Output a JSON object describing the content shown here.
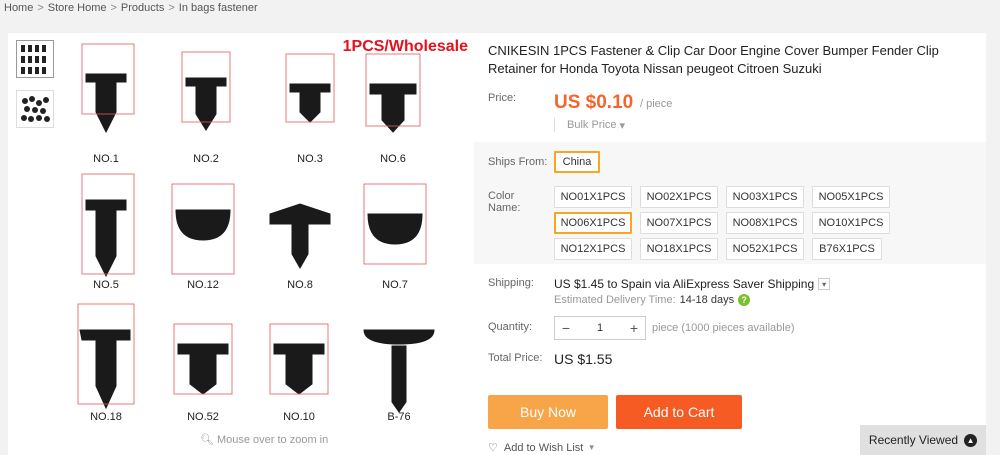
{
  "breadcrumb": [
    "Home",
    "Store Home",
    "Products",
    "In bags fastener"
  ],
  "image": {
    "overlay_title": "1PCS/Wholesale",
    "zoom_hint": "Mouse over to zoom in",
    "labels": [
      "NO.1",
      "NO.2",
      "NO.3",
      "NO.6",
      "NO.5",
      "NO.12",
      "NO.8",
      "NO.7",
      "NO.18",
      "NO.52",
      "NO.10",
      "B-76"
    ]
  },
  "product": {
    "title": "CNIKESIN 1PCS Fastener & Clip Car Door Engine Cover Bumper Fender Clip Retainer for Honda Toyota Nissan peugeot Citroen Suzuki",
    "price_label": "Price:",
    "price": "US $0.10",
    "price_unit": "/ piece",
    "bulk_price": "Bulk Price"
  },
  "sku": {
    "ships_from_label": "Ships From:",
    "ships_from": "China",
    "color_label_1": "Color",
    "color_label_2": "Name:",
    "options": [
      "NO01X1PCS",
      "NO02X1PCS",
      "NO03X1PCS",
      "NO05X1PCS",
      "NO06X1PCS",
      "NO07X1PCS",
      "NO08X1PCS",
      "NO10X1PCS",
      "NO12X1PCS",
      "NO18X1PCS",
      "NO52X1PCS",
      "B76X1PCS"
    ],
    "selected_option": "NO06X1PCS"
  },
  "shipping": {
    "label": "Shipping:",
    "text": "US $1.45 to Spain via AliExpress Saver Shipping",
    "delivery_label": "Estimated Delivery Time:",
    "delivery_value": "14-18 days"
  },
  "quantity": {
    "label": "Quantity:",
    "value": "1",
    "minus": "−",
    "plus": "+",
    "note": "piece (1000 pieces available)"
  },
  "total": {
    "label": "Total Price:",
    "value": "US $1.55"
  },
  "actions": {
    "buy_now": "Buy Now",
    "add_to_cart": "Add to Cart",
    "wishlist": "Add to Wish List"
  },
  "recently_viewed": "Recently Viewed",
  "colors": {
    "price": "#f5652b",
    "buy_now": "#f8a54a",
    "add_to_cart": "#f55b22",
    "selected_border": "#f5a623",
    "overlay_title": "#e8101d"
  }
}
